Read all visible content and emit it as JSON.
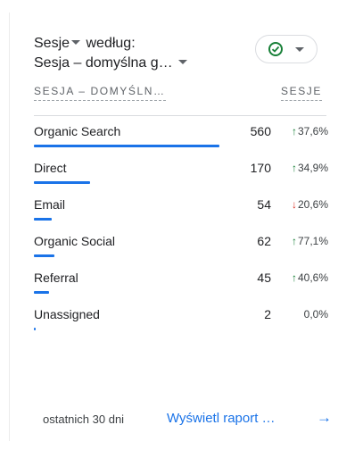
{
  "card": {
    "title_line1": "Sesje",
    "title_line1_rest": "według:",
    "title_line2": "Sesja – domyślna g…",
    "status_icon": "check-circle-icon",
    "col_dimension": "SESJA – DOMYŚLN…",
    "col_metric": "SESJE"
  },
  "rows": [
    {
      "name": "Organic Search",
      "value": "560",
      "change": "37,6%",
      "trend": "up",
      "share": 1.0
    },
    {
      "name": "Direct",
      "value": "170",
      "change": "34,9%",
      "trend": "up",
      "share": 0.3036
    },
    {
      "name": "Email",
      "value": "54",
      "change": "20,6%",
      "trend": "down",
      "share": 0.0964
    },
    {
      "name": "Organic Social",
      "value": "62",
      "change": "77,1%",
      "trend": "up",
      "share": 0.1107
    },
    {
      "name": "Referral",
      "value": "45",
      "change": "40,6%",
      "trend": "up",
      "share": 0.0804
    },
    {
      "name": "Unassigned",
      "value": "2",
      "change": "0,0%",
      "trend": "flat",
      "share": 0.0036
    }
  ],
  "footer": {
    "period": "ostatnich 30 dni",
    "link": "Wyświetl raport …",
    "arrow_icon": "arrow-right-icon"
  },
  "colors": {
    "accent": "#1a73e8",
    "up": "#188038",
    "down": "#d93025"
  }
}
